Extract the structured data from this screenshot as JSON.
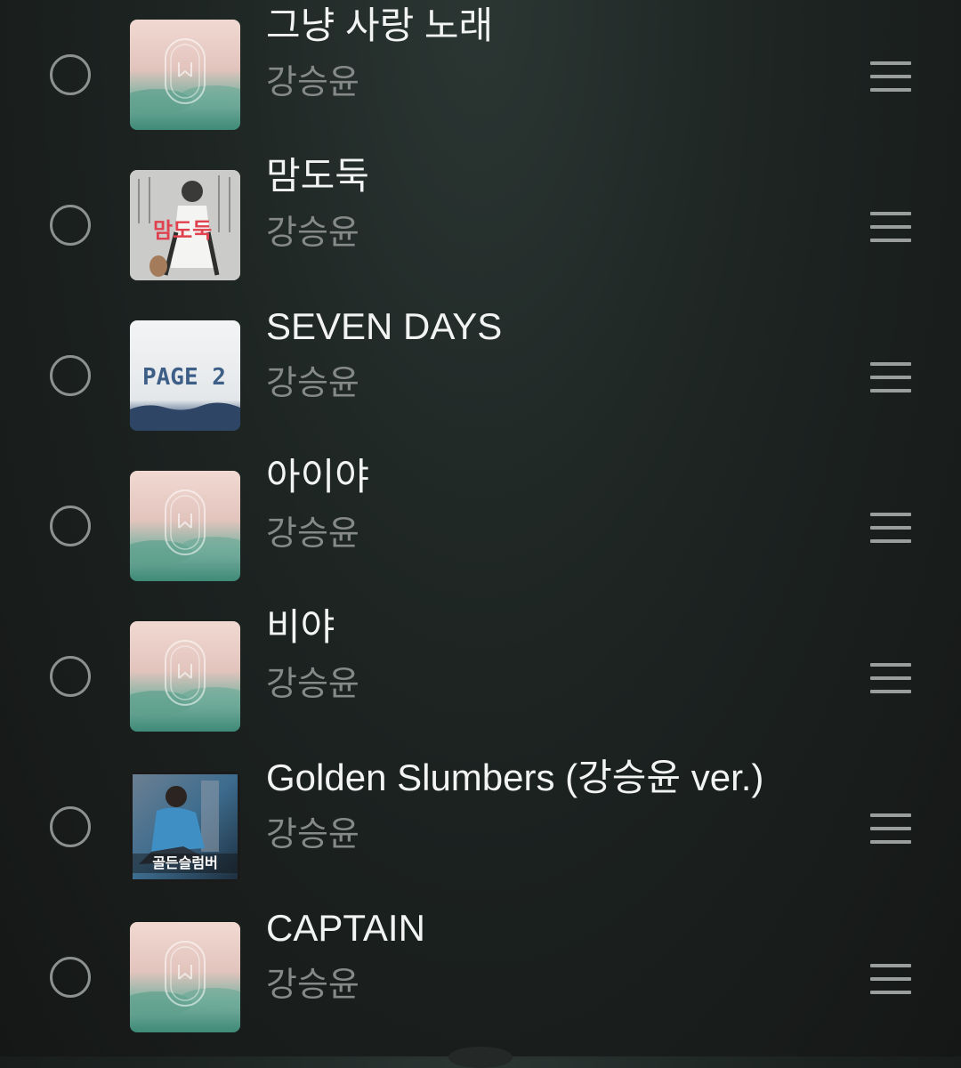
{
  "tracks": [
    {
      "title": "그냥 사랑 노래",
      "artist": "강승윤",
      "art_icon": "album-art-mist"
    },
    {
      "title": "맘도둑",
      "artist": "강승윤",
      "art_icon": "album-art-photo",
      "art_text": "맘도둑"
    },
    {
      "title": "SEVEN DAYS",
      "artist": "강승윤",
      "art_icon": "album-art-page2",
      "art_text": "PAGE 2"
    },
    {
      "title": "아이야",
      "artist": "강승윤",
      "art_icon": "album-art-mist"
    },
    {
      "title": "비야",
      "artist": "강승윤",
      "art_icon": "album-art-mist"
    },
    {
      "title": "Golden Slumbers (강승윤 ver.)",
      "artist": "강승윤",
      "art_icon": "album-art-golden",
      "art_text": "골든슬럼버"
    },
    {
      "title": "CAPTAIN",
      "artist": "강승윤",
      "art_icon": "album-art-mist"
    }
  ],
  "colors": {
    "title": "#f2f4f3",
    "artist": "#858a88",
    "radio_border": "#8d918f",
    "handle": "#9a9e9c"
  }
}
